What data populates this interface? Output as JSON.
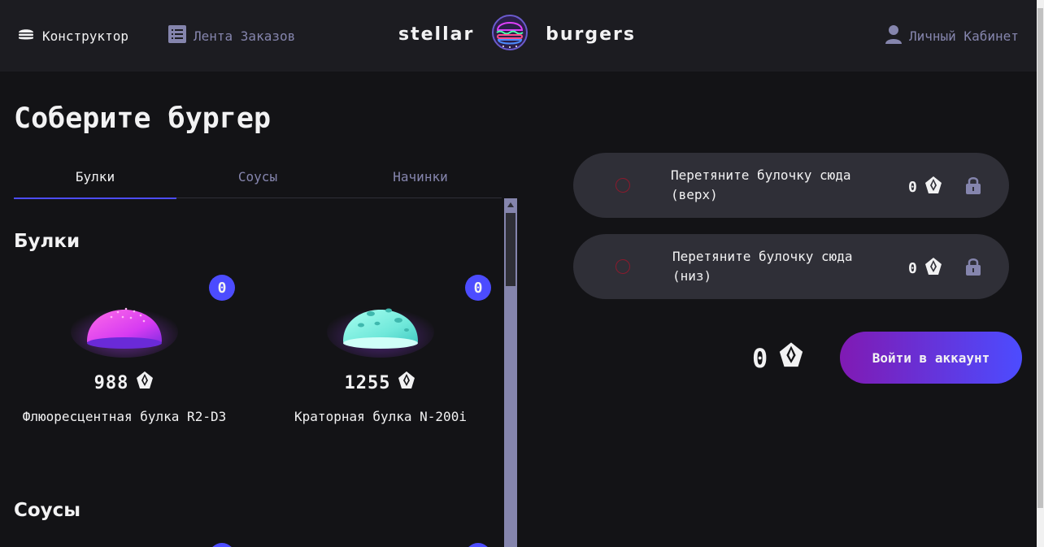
{
  "header": {
    "nav": {
      "constructor": "Конструктор",
      "feed": "Лента Заказов",
      "account": "Личный Кабинет"
    },
    "logo": {
      "left": "stellar",
      "right": "burgers"
    }
  },
  "main": {
    "title": "Соберите бургер",
    "tabs": [
      {
        "label": "Булки",
        "active": true
      },
      {
        "label": "Соусы",
        "active": false
      },
      {
        "label": "Начинки",
        "active": false
      }
    ],
    "sections": {
      "buns": {
        "title": "Булки",
        "items": [
          {
            "name": "Флюоресцентная булка R2-D3",
            "price": "988",
            "count": "0",
            "color": "#E040FB"
          },
          {
            "name": "Краторная булка N-200i",
            "price": "1255",
            "count": "0",
            "color": "#7EF2E0"
          }
        ]
      },
      "sauces": {
        "title": "Соусы"
      }
    }
  },
  "constructor": {
    "top_bun": {
      "text": "Перетяните булочку сюда (верх)",
      "price": "0"
    },
    "bottom_bun": {
      "text": "Перетяните булочку сюда (низ)",
      "price": "0"
    },
    "total": "0",
    "login_button": "Войти в аккаунт"
  },
  "colors": {
    "accent": "#4C4CFF",
    "background": "#131316",
    "panel": "#1C1C21",
    "inactive_text": "#8585AD",
    "button_gradient_start": "#801AB3",
    "button_gradient_end": "#4C4CFF"
  },
  "icons": [
    "burger-icon",
    "list-icon",
    "profile-icon",
    "currency-icon",
    "lock-icon"
  ]
}
